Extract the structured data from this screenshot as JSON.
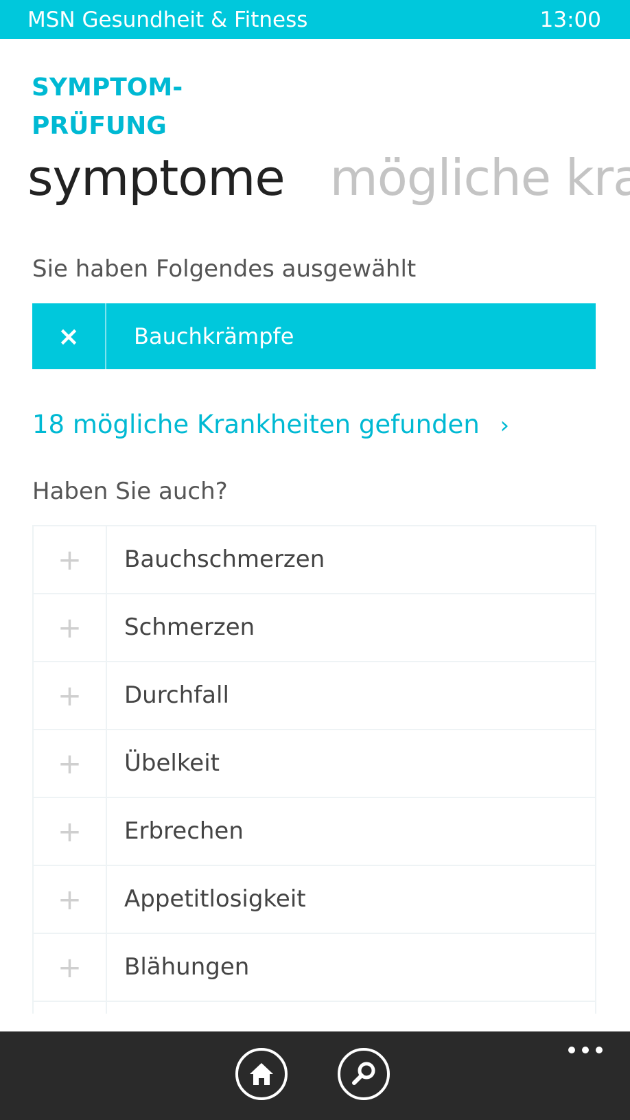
{
  "status_bar": {
    "app_name": "MSN Gesundheit & Fitness",
    "time": "13:00"
  },
  "header": {
    "section_title": "SYMPTOM-\nPRÜFUNG",
    "pivot_active": "symptome",
    "pivot_next": "mögliche krank"
  },
  "selected": {
    "label": "Sie haben Folgendes ausgewählt",
    "remove_icon": "×",
    "items": [
      {
        "label": "Bauchkrämpfe"
      }
    ]
  },
  "results": {
    "link_text": "18 mögliche Krankheiten gefunden",
    "chevron": "›"
  },
  "suggestions": {
    "label": "Haben Sie auch?",
    "add_icon": "+",
    "items": [
      {
        "label": "Bauchschmerzen"
      },
      {
        "label": "Schmerzen"
      },
      {
        "label": "Durchfall"
      },
      {
        "label": "Übelkeit"
      },
      {
        "label": "Erbrechen"
      },
      {
        "label": "Appetitlosigkeit"
      },
      {
        "label": "Blähungen"
      },
      {
        "label": ""
      }
    ]
  },
  "app_bar": {
    "buttons": [
      {
        "icon": "home-icon"
      },
      {
        "icon": "search-icon"
      }
    ],
    "more_icon": "more-dots-icon"
  },
  "colors": {
    "accent": "#00c8dc",
    "accent_text": "#00b9d3",
    "app_bar": "#2a2a2a"
  }
}
